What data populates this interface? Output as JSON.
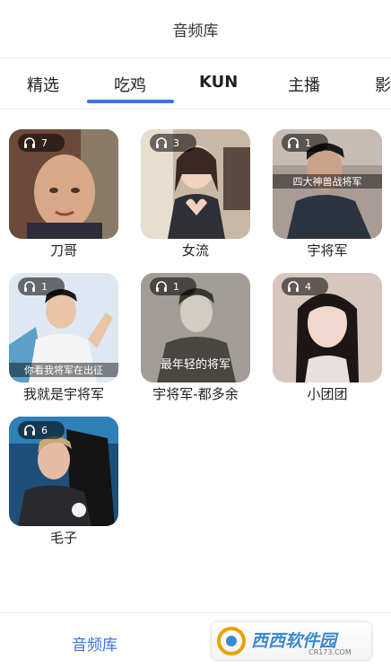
{
  "header": {
    "title": "音频库"
  },
  "tabs": [
    {
      "label": "精选"
    },
    {
      "label": "吃鸡",
      "selected": true
    },
    {
      "label": "KUN"
    },
    {
      "label": "主播"
    },
    {
      "label": "影"
    }
  ],
  "accent_color": "#3a73e8",
  "grid": {
    "items": [
      {
        "name": "刀哥",
        "plays": "7",
        "icon": "headphones-icon"
      },
      {
        "name": "女流",
        "plays": "3",
        "icon": "headphones-icon"
      },
      {
        "name": "宇将军",
        "plays": "1",
        "icon": "headphones-icon",
        "caption": "四大神兽战将军"
      },
      {
        "name": "我就是宇将军",
        "plays": "1",
        "icon": "headphones-icon",
        "caption": "你看我将军在出征"
      },
      {
        "name": "宇将军-都多余",
        "plays": "1",
        "icon": "headphones-icon",
        "caption": "最年轻的将军"
      },
      {
        "name": "小团团",
        "plays": "4",
        "icon": "headphones-icon"
      },
      {
        "name": "毛子",
        "plays": "6",
        "icon": "headphones-icon"
      }
    ]
  },
  "footer": {
    "nav_label": "音频库"
  },
  "watermark": {
    "text": "西西软件园",
    "site": "CR173.COM"
  }
}
